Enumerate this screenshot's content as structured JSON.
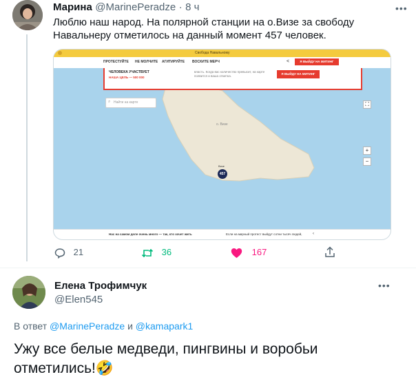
{
  "tweet1": {
    "author_name": "Марина",
    "handle": "@MarinePeradze",
    "dot": "·",
    "time": "8 ч",
    "text": "Люблю наш народ. На полярной станции на о.Визе за свободу Навальнеру отметилось на данный момент 457 человек.",
    "media": {
      "browser_tab": "Свобода Навальному",
      "nav": [
        "ПРОТЕСТУЙТЕ",
        "НЕ МОЛЧИТЕ",
        "АГИТИРУЙТЕ",
        "ВОСХИТЕ МЕРЧ"
      ],
      "card_left_line1": "ЧЕЛОВЕКА УЧАСТВУЕТ",
      "card_left_line2": "НАША ЦЕЛЬ — 500 000",
      "card_mid": "власть. Когда вас количество превысит, на карте появится и ваша отметка.",
      "card_button": "Я ВЫЙДУ НА МИТИНГ",
      "top_button": "Я ВЫЙДУ НА МИТИНГ",
      "search_placeholder": "Найти на карте",
      "island_label": "о. Визе",
      "marker_count": "457",
      "marker_label": "Визе",
      "footer_left": "Нас на самом деле очень много — так, кто хочет жить",
      "footer_right": "Если на мирный протест выйдут сотни тысяч людей,"
    },
    "actions": {
      "replies": "21",
      "retweets": "36",
      "likes": "167"
    },
    "colors": {
      "retweet": "#00ba7c",
      "like": "#f91880",
      "link": "#1d9bf0",
      "accent": "#e63b2e"
    }
  },
  "tweet2": {
    "author_name": "Елена Трофимчук",
    "handle": "@Elen545",
    "reply_prefix": "В ответ",
    "reply_user1": "@MarinePeradze",
    "reply_and": "и",
    "reply_user2": "@kamapark1",
    "text": "Ужу все белые медведи, пингвины и воробьи отметились!🤣"
  },
  "icons": [
    "more-icon",
    "reply-icon",
    "retweet-icon",
    "like-icon",
    "share-icon",
    "zoom-in-icon",
    "zoom-out-icon",
    "fullscreen-icon",
    "share-small-icon"
  ]
}
